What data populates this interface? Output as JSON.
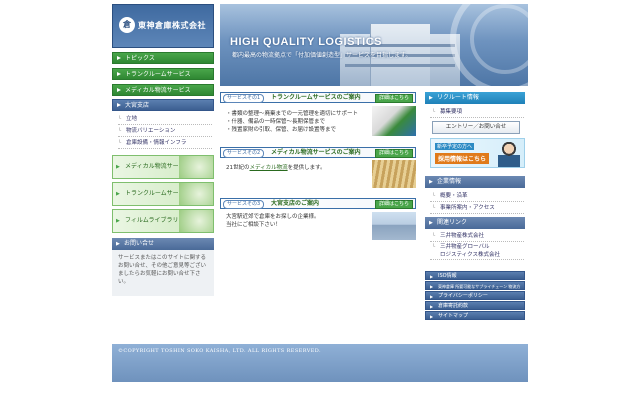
{
  "brand": {
    "logo_mark": "倉",
    "company": "東神倉庫株式会社"
  },
  "hero": {
    "title": "HIGH QUALITY LOGISTICS",
    "subtitle": "都内最高の物流拠点で「付加価値創造型」サービスを目指します。"
  },
  "nav": {
    "items": [
      {
        "label": "トピックス"
      },
      {
        "label": "トランクルームサービス"
      },
      {
        "label": "メディカル物流サービス"
      },
      {
        "label": "大宮支店"
      }
    ],
    "sub_items": [
      {
        "label": "立地"
      },
      {
        "label": "物流バリエーション"
      },
      {
        "label": "倉庫設備・情報インフラ"
      }
    ],
    "banners": [
      {
        "label": "メディカル物流サービス"
      },
      {
        "label": "トランクルームサービス"
      },
      {
        "label": "フィルムライブラリー"
      }
    ]
  },
  "contact": {
    "heading": "お問い合せ",
    "body": "サービスまたはこのサイトに関するお問い合せ、その他ご意見等ございましたらお気軽にお問い合せ下さい。"
  },
  "services": [
    {
      "tag": "サービスその1",
      "name": "トランクルームサービスのご案内",
      "more": "詳細はこちら",
      "lines": [
        "・書類の整理〜廃棄までの一元管理を適切にサポート",
        "・什器、備品の一時保管〜長期保管まで",
        "・残置家財の引取、保管、お届け設置等まで"
      ]
    },
    {
      "tag": "サービスその2",
      "name": "メディカル物流サービスのご案内",
      "more": "詳細はこちら",
      "text_before": "21世紀の",
      "text_link": "メディカル物流",
      "text_after": "を提供します。"
    },
    {
      "tag": "サービスその3",
      "name": "大宮支店のご案内",
      "more": "詳細はこちら",
      "lines": [
        "大宮駅近郊で倉庫をお探しの企業様。",
        "当社にご相談下さい！"
      ]
    }
  ],
  "recruit": {
    "heading": "リクルート情報",
    "item": "募集要項",
    "entry_button": "エントリー／お問い合せ",
    "box_small": "新卒予定の方へ",
    "box_big": "採用情報はこちら"
  },
  "company": {
    "heading": "企業情報",
    "items": [
      {
        "label": "概要・沿革"
      },
      {
        "label": "事業所案内・アクセス"
      }
    ]
  },
  "related": {
    "heading": "関連リンク",
    "items": [
      {
        "label": "三井物産株式会社"
      },
      {
        "label": "三井物産グローバル\nロジスティクス株式会社"
      }
    ]
  },
  "misc_links": [
    {
      "label": "ISO情報"
    },
    {
      "label": "東神倉庫 所要可能なサプライチェーン 物流方針"
    },
    {
      "label": "プライバシーポリシー"
    },
    {
      "label": "倉庫寄託約款"
    },
    {
      "label": "サイトマップ"
    }
  ],
  "footer": {
    "copyright": "©COPYRIGHT TOSHIN SOKO KAISHA, LTD. ALL RIGHTS RESERVED."
  }
}
